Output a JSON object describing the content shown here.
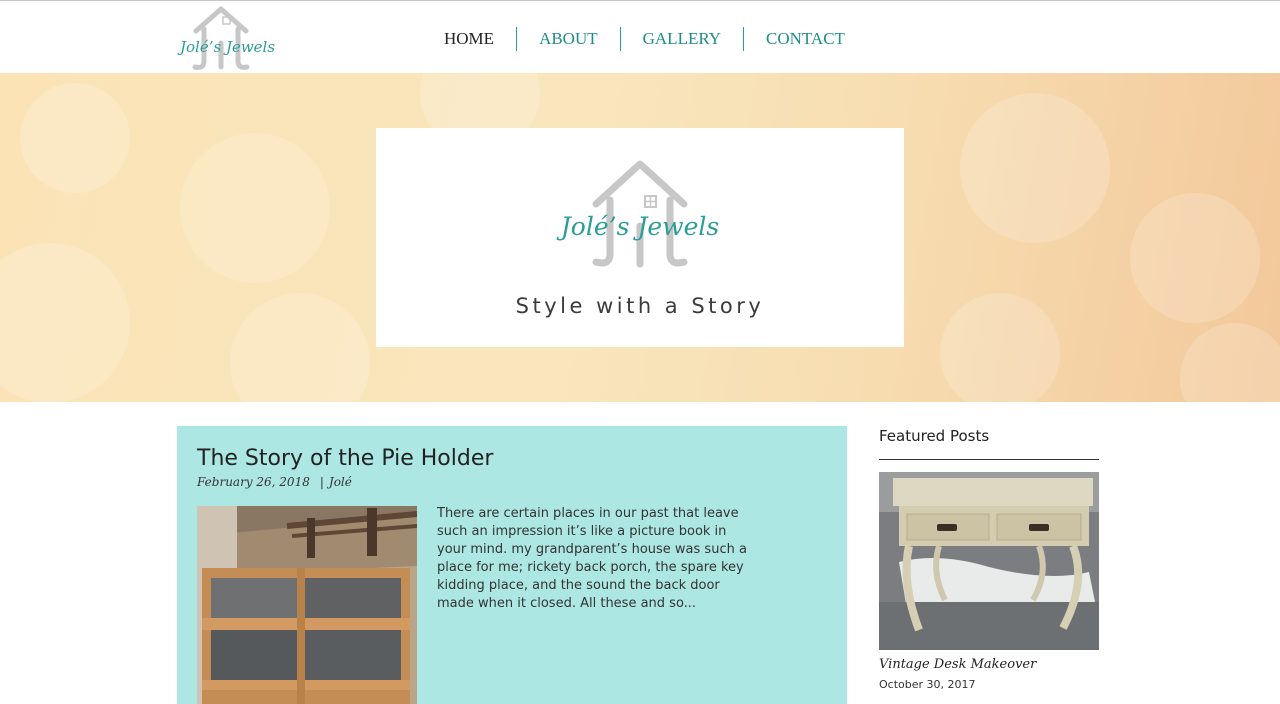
{
  "brand": {
    "name": "Jolé’s Jewels",
    "tagline": "Style with a Story"
  },
  "nav": {
    "items": [
      "HOME",
      "ABOUT",
      "GALLERY",
      "CONTACT"
    ],
    "active": "HOME"
  },
  "colors": {
    "accent": "#2a9d96",
    "post_background": "#ade7e4",
    "logo_gray": "#c7c7c7"
  },
  "post": {
    "title": "The Story of the Pie Holder",
    "date": "February 26, 2018",
    "author": "Jolé",
    "excerpt": "There are certain places in our past that leave such an impression it’s like a picture book in your mind. my grandparent’s house was such a place for me; rickety back porch, the spare key kidding place, and the sound the back door made when it closed. All these and so..."
  },
  "featured": {
    "heading": "Featured Posts",
    "items": [
      {
        "title": "Vintage Desk Makeover",
        "date": "October 30, 2017"
      }
    ]
  }
}
